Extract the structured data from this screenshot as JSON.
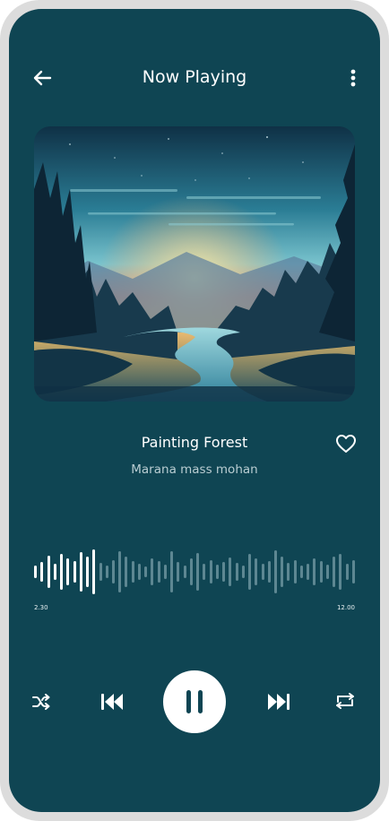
{
  "header": {
    "title": "Now Playing",
    "back_icon": "arrow-left-icon",
    "menu_icon": "more-vertical-icon"
  },
  "track": {
    "title": "Painting Forest",
    "artist": "Marana mass mohan",
    "liked_icon": "heart-outline-icon"
  },
  "progress": {
    "current_time": "2.30",
    "total_time": "12.00",
    "played_fraction": 0.19
  },
  "controls": {
    "shuffle_icon": "shuffle-icon",
    "previous_icon": "skip-previous-icon",
    "play_state_icon": "pause-icon",
    "next_icon": "skip-next-icon",
    "repeat_icon": "repeat-icon"
  },
  "colors": {
    "background": "#0f4553",
    "frame": "#dcdcdc",
    "wave_played": "#ffffff",
    "wave_unplayed": "#5d8792"
  }
}
